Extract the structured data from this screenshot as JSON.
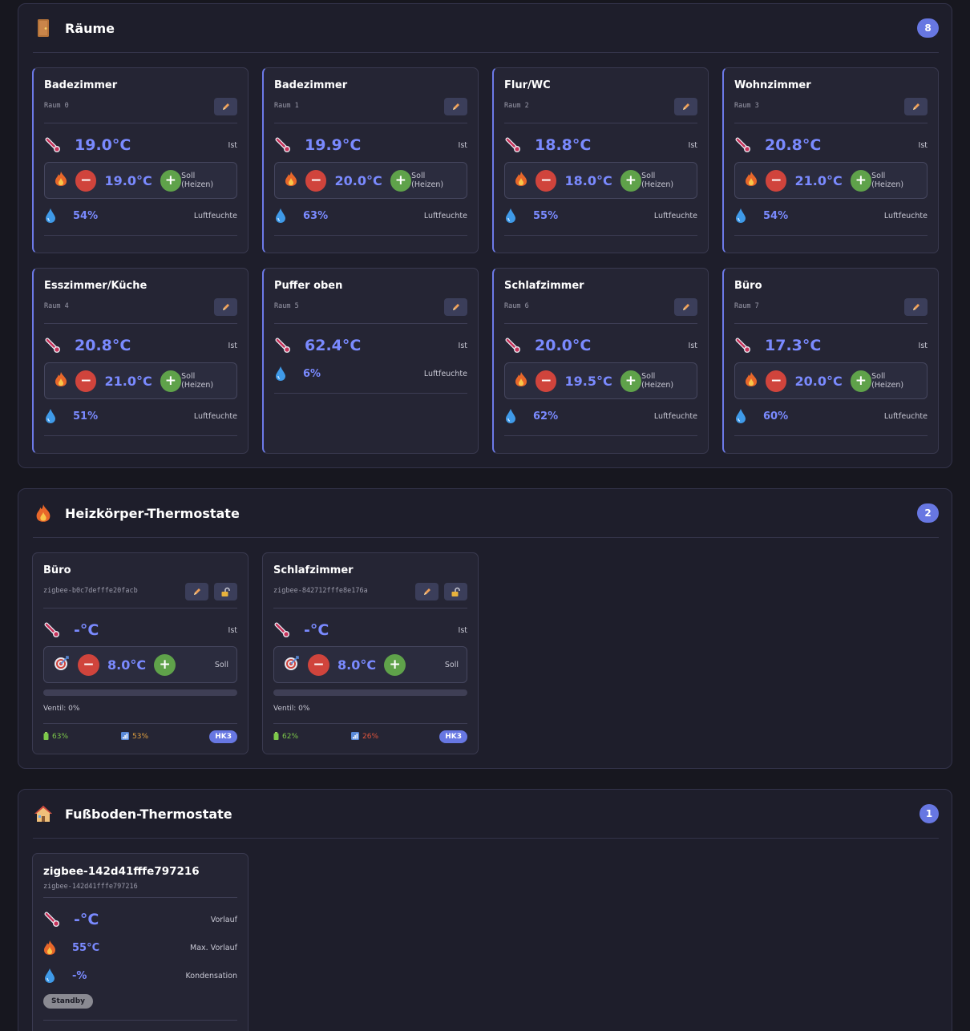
{
  "rooms": {
    "title": "Räume",
    "count": "8",
    "labels": {
      "ist": "Ist",
      "soll": "Soll (Heizen)",
      "humidity": "Luftfeuchte"
    },
    "items": [
      {
        "name": "Badezimmer",
        "sub": "Raum 0",
        "temp": "19.0°C",
        "set": "19.0°C",
        "hum": "54%"
      },
      {
        "name": "Badezimmer",
        "sub": "Raum 1",
        "temp": "19.9°C",
        "set": "20.0°C",
        "hum": "63%"
      },
      {
        "name": "Flur/WC",
        "sub": "Raum 2",
        "temp": "18.8°C",
        "set": "18.0°C",
        "hum": "55%"
      },
      {
        "name": "Wohnzimmer",
        "sub": "Raum 3",
        "temp": "20.8°C",
        "set": "21.0°C",
        "hum": "54%"
      },
      {
        "name": "Esszimmer/Küche",
        "sub": "Raum 4",
        "temp": "20.8°C",
        "set": "21.0°C",
        "hum": "51%"
      },
      {
        "name": "Puffer oben",
        "sub": "Raum 5",
        "temp": "62.4°C",
        "set": "",
        "hum": "6%"
      },
      {
        "name": "Schlafzimmer",
        "sub": "Raum 6",
        "temp": "20.0°C",
        "set": "19.5°C",
        "hum": "62%"
      },
      {
        "name": "Büro",
        "sub": "Raum 7",
        "temp": "17.3°C",
        "set": "20.0°C",
        "hum": "60%"
      }
    ]
  },
  "radiators": {
    "title": "Heizkörper-Thermostate",
    "count": "2",
    "labels": {
      "ist": "Ist",
      "soll": "Soll"
    },
    "items": [
      {
        "name": "Büro",
        "sub": "zigbee-b0c7defffe20facb",
        "temp": "-°C",
        "set": "8.0°C",
        "valve": "Ventil: 0%",
        "valve_pct": 0,
        "battery": "63%",
        "signal": "53%",
        "signal_color": "#e0a040",
        "circuit": "HK3"
      },
      {
        "name": "Schlafzimmer",
        "sub": "zigbee-842712fffe8e176a",
        "temp": "-°C",
        "set": "8.0°C",
        "valve": "Ventil: 0%",
        "valve_pct": 0,
        "battery": "62%",
        "signal": "26%",
        "signal_color": "#e0553c",
        "circuit": "HK3"
      }
    ]
  },
  "floor": {
    "title": "Fußboden-Thermostate",
    "count": "1",
    "items": [
      {
        "name": "zigbee-142d41fffe797216",
        "sub": "zigbee-142d41fffe797216",
        "flow": "-°C",
        "flow_label": "Vorlauf",
        "max_flow": "55°C",
        "max_flow_label": "Max. Vorlauf",
        "condensation": "-%",
        "condensation_label": "Kondensation",
        "status": "Standby"
      }
    ]
  },
  "colors": {
    "accent": "#6777e2",
    "value": "#7a8aff",
    "minus": "#d0443c",
    "plus": "#5fa24a",
    "battery": "#7cc84a"
  }
}
